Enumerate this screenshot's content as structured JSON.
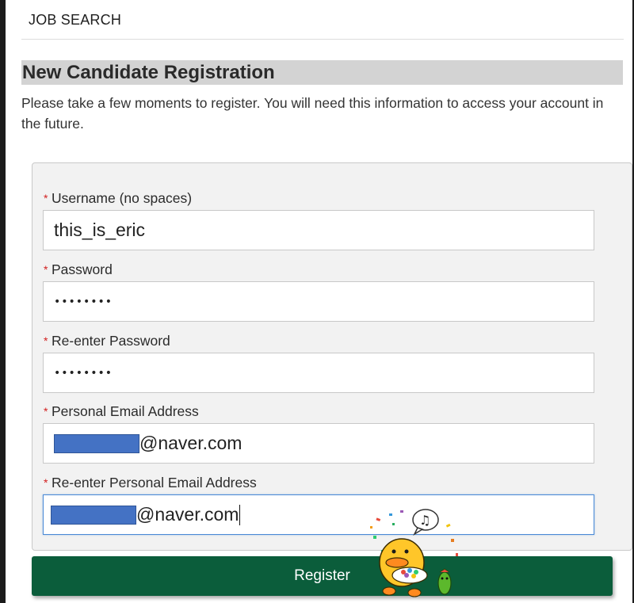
{
  "header": {
    "title": "JOB SEARCH"
  },
  "page": {
    "heading": "New Candidate Registration",
    "intro": "Please take a few moments to register. You will need this information to access your account in the future."
  },
  "form": {
    "required_marker": "*",
    "fields": [
      {
        "label": "Username (no spaces)",
        "value": "this_is_eric",
        "type": "text"
      },
      {
        "label": "Password",
        "value": "••••••••",
        "type": "password"
      },
      {
        "label": "Re-enter Password",
        "value": "••••••••",
        "type": "password"
      },
      {
        "label": "Personal Email Address",
        "value": "@naver.com",
        "type": "email",
        "redacted_prefix": true
      },
      {
        "label": "Re-enter Personal Email Address",
        "value": "@naver.com",
        "type": "email",
        "redacted_prefix": true,
        "focused": true
      }
    ],
    "submit_label": "Register"
  },
  "colors": {
    "heading_bg": "#d3d3d3",
    "panel_bg": "#f2f2f2",
    "required": "#d21f1f",
    "button": "#0b5d3b",
    "redaction": "#4472c4",
    "focus_border": "#4a8ad6"
  },
  "decorations": {
    "sticker": "duck-character-sticker"
  }
}
